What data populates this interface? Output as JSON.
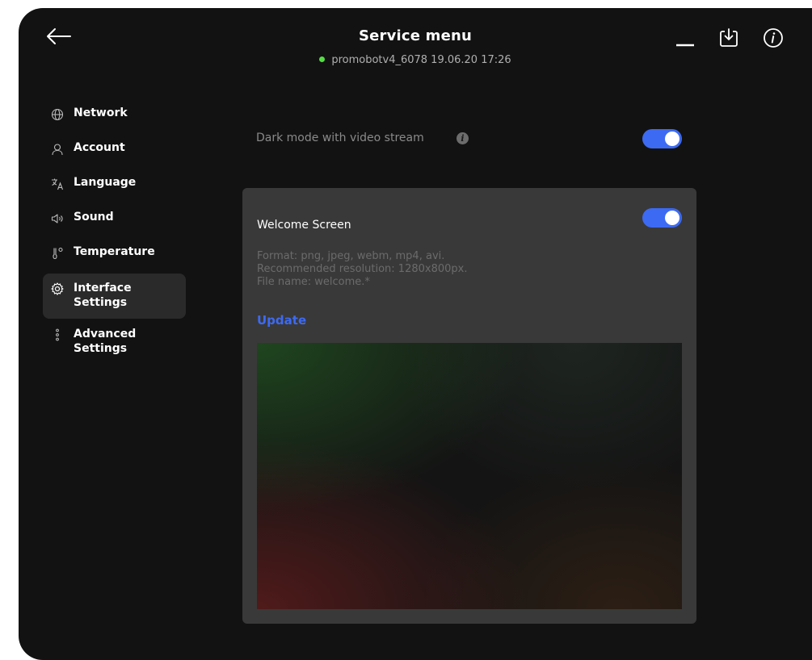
{
  "header": {
    "title": "Service menu",
    "status_text": "promobotv4_6078 19.06.20  17:26",
    "status_color": "#55dd44",
    "icons": [
      "back-arrow-icon",
      "minimize-icon",
      "download-icon",
      "info-icon"
    ]
  },
  "sidebar": {
    "items": [
      {
        "label": "Network",
        "icon": "globe-icon"
      },
      {
        "label": "Account",
        "icon": "person-icon"
      },
      {
        "label": "Language",
        "icon": "translate-icon"
      },
      {
        "label": "Sound",
        "icon": "speaker-icon"
      },
      {
        "label": "Temperature",
        "icon": "thermometer-icon"
      },
      {
        "label": "Interface Settings",
        "icon": "gear-icon",
        "active": true
      },
      {
        "label": "Advanced Settings",
        "icon": "dots-vertical-icon"
      }
    ]
  },
  "settings": {
    "dark_mode": {
      "label": "Dark mode with video stream",
      "info_glyph": "i",
      "enabled": true
    },
    "welcome_screen": {
      "title": "Welcome Screen",
      "enabled": true,
      "format_line": "Format: png, jpeg, webm, mp4, avi.",
      "resolution_line": "Recommended resolution: 1280x800px.",
      "filename_line": "File name: welcome.*",
      "update_label": "Update"
    }
  },
  "colors": {
    "accent": "#3d6af2",
    "background": "#121212",
    "card": "#393939"
  }
}
